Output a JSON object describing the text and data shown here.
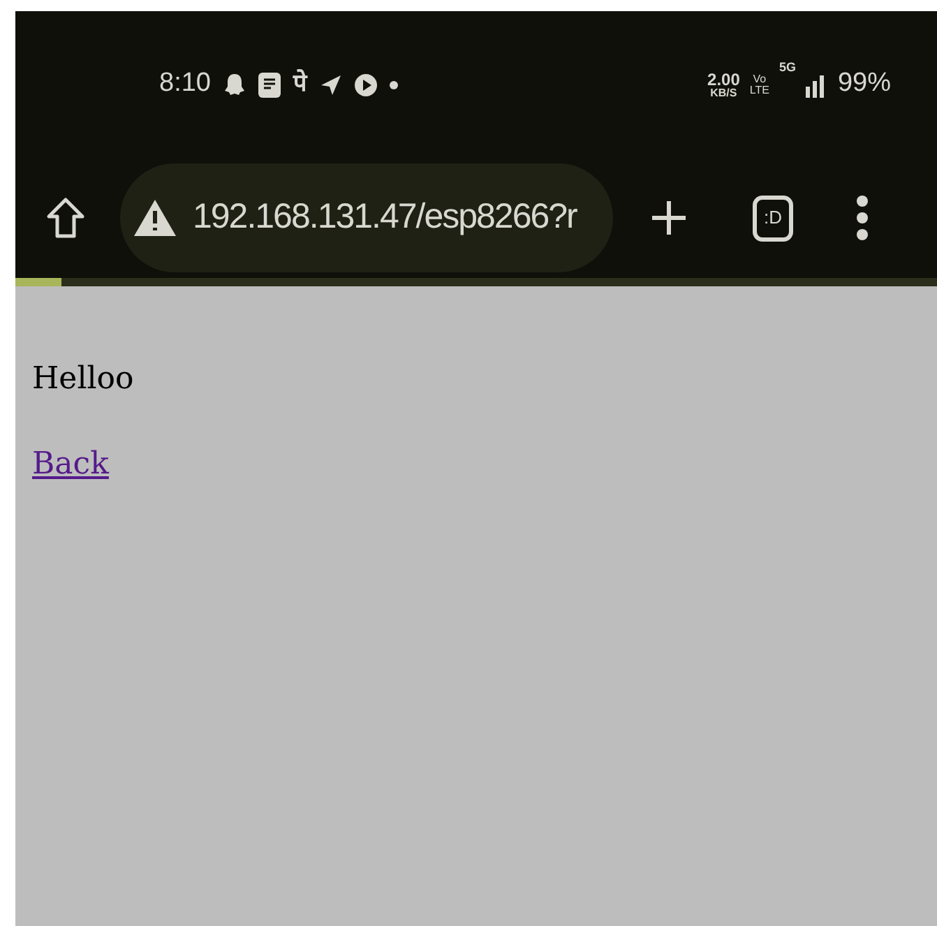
{
  "status_bar": {
    "time": "8:10",
    "app_glyph": "पे",
    "speed": "2.00",
    "speed_unit": "KB/S",
    "volte_top": "Vo",
    "volte_bottom": "LTE",
    "network": "5G",
    "battery": "99%"
  },
  "toolbar": {
    "url": "192.168.131.47/esp8266?r",
    "tabs_label": ":D"
  },
  "progress": {
    "level": 0.05
  },
  "page": {
    "text": "Helloo",
    "link": "Back"
  }
}
